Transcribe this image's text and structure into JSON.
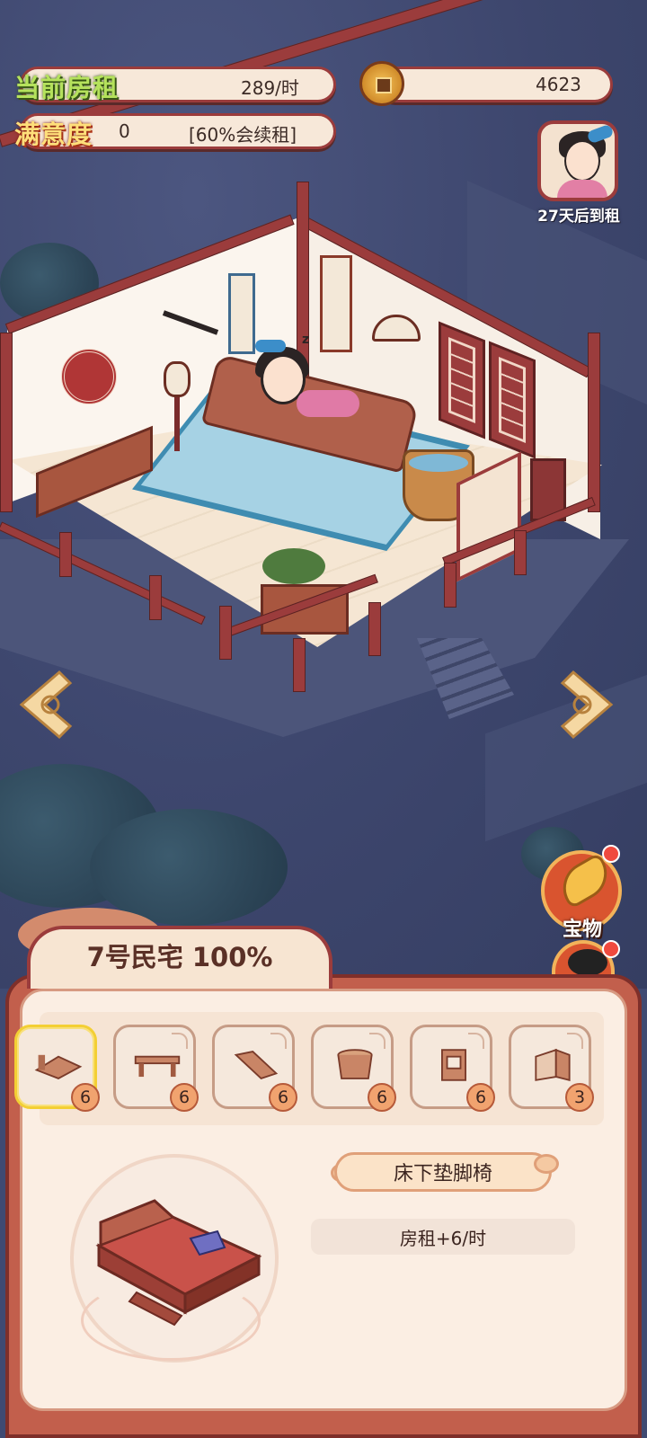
{
  "stats": {
    "rent_label": "当前房租",
    "rent_value": "289/时",
    "coins_value": "4623",
    "satisfaction_label": "满意度",
    "satisfaction_value": "0",
    "renewal_note": "[60%会续租]"
  },
  "tenant": {
    "countdown": "27天后到租"
  },
  "side_buttons": {
    "treasure_label": "宝物"
  },
  "panel": {
    "title": "7号民宅 100%",
    "furniture_slots": [
      {
        "icon": "bed-icon",
        "count": "6",
        "selected": true
      },
      {
        "icon": "table-icon",
        "count": "6",
        "selected": false
      },
      {
        "icon": "scroll-icon",
        "count": "6",
        "selected": false
      },
      {
        "icon": "tub-icon",
        "count": "6",
        "selected": false
      },
      {
        "icon": "cabinet-icon",
        "count": "6",
        "selected": false
      },
      {
        "icon": "screen-icon",
        "count": "3",
        "selected": false
      }
    ],
    "selected_item_name": "床下垫脚椅",
    "selected_item_effect": "房租+6/时"
  },
  "colors": {
    "frame_red": "#9b3c3c",
    "panel_cream": "#fbeee3",
    "night_blue": "#3f4a72",
    "selected_gold": "#f3cf34"
  }
}
